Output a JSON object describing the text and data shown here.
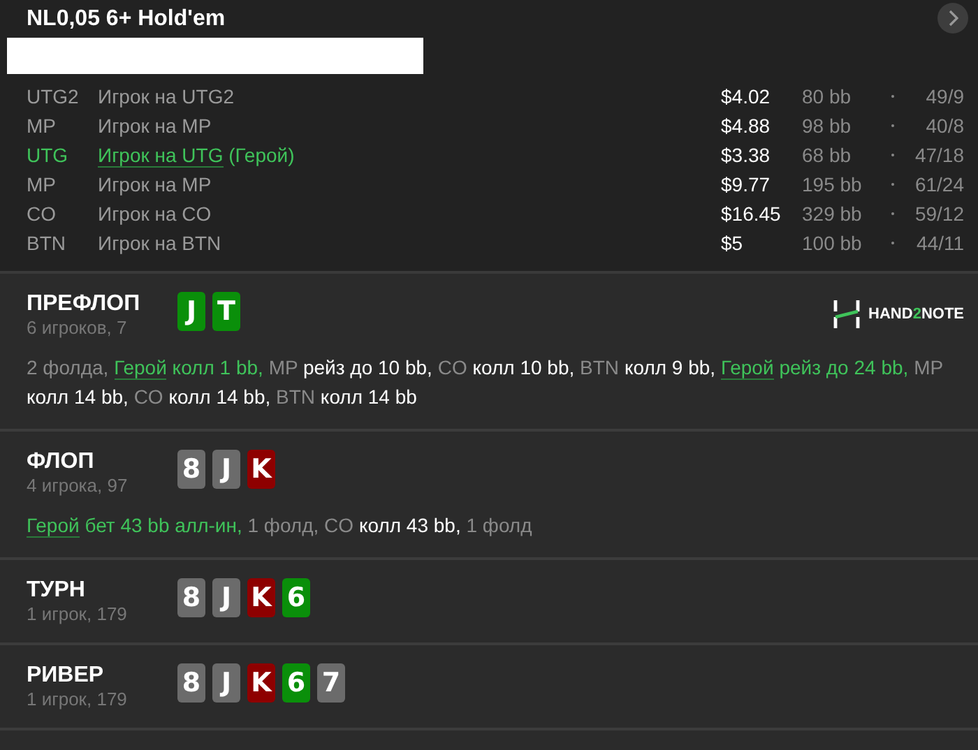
{
  "header": {
    "title": "NL0,05 6+ Hold'em"
  },
  "players": [
    {
      "position": "UTG2",
      "name": "Игрок на UTG2",
      "hero": false,
      "stack": "$4.02",
      "bb": "80 bb",
      "stats": "49/9"
    },
    {
      "position": "MP",
      "name": "Игрок на MP",
      "hero": false,
      "stack": "$4.88",
      "bb": "98 bb",
      "stats": "40/8"
    },
    {
      "position": "UTG",
      "name": "Игрок на UTG",
      "hero": true,
      "hero_tag": "(Герой)",
      "stack": "$3.38",
      "bb": "68 bb",
      "stats": "47/18"
    },
    {
      "position": "MP",
      "name": "Игрок на MP",
      "hero": false,
      "stack": "$9.77",
      "bb": "195 bb",
      "stats": "61/24"
    },
    {
      "position": "CO",
      "name": "Игрок на CO",
      "hero": false,
      "stack": "$16.45",
      "bb": "329 bb",
      "stats": "59/12"
    },
    {
      "position": "BTN",
      "name": "Игрок на BTN",
      "hero": false,
      "stack": "$5",
      "bb": "100 bb",
      "stats": "44/11"
    }
  ],
  "streets": [
    {
      "name": "ПРЕФЛОП",
      "info": "6 игроков, 7",
      "logo": [
        {
          "text": "HAND",
          "accent": false
        },
        {
          "text": "2",
          "accent": true
        },
        {
          "text": "NOTE",
          "accent": false
        }
      ],
      "cards": [
        {
          "rank": "J",
          "color": "#0a8f0a"
        },
        {
          "rank": "T",
          "color": "#0a8f0a"
        }
      ],
      "actions": [
        {
          "kind": "muted",
          "text": "2 фолда,"
        },
        {
          "kind": "hero",
          "text": "Герой"
        },
        {
          "kind": "hero_action",
          "text": "колл 1 bb,"
        },
        {
          "kind": "muted",
          "text": "MP"
        },
        {
          "kind": "action",
          "text": "рейз до 10 bb,"
        },
        {
          "kind": "muted",
          "text": "CO"
        },
        {
          "kind": "action",
          "text": "колл 10 bb,"
        },
        {
          "kind": "muted",
          "text": "BTN"
        },
        {
          "kind": "action",
          "text": "колл 9 bb,"
        },
        {
          "kind": "hero",
          "text": "Герой"
        },
        {
          "kind": "hero_action",
          "text": "рейз до 24 bb,"
        },
        {
          "kind": "muted",
          "text": "MP"
        },
        {
          "kind": "action",
          "text": "колл 14 bb,"
        },
        {
          "kind": "muted",
          "text": "CO"
        },
        {
          "kind": "action",
          "text": "колл 14 bb,"
        },
        {
          "kind": "muted",
          "text": "BTN"
        },
        {
          "kind": "action",
          "text": "колл 14 bb"
        }
      ]
    },
    {
      "name": "ФЛОП",
      "info": "4 игрока, 97",
      "cards": [
        {
          "rank": "8",
          "color": "#6b6b6b"
        },
        {
          "rank": "J",
          "color": "#6b6b6b"
        },
        {
          "rank": "K",
          "color": "#8e0000"
        }
      ],
      "actions": [
        {
          "kind": "hero",
          "text": "Герой"
        },
        {
          "kind": "hero_action",
          "text": "бет 43 bb алл-ин,"
        },
        {
          "kind": "muted",
          "text": "1 фолд, CO"
        },
        {
          "kind": "action",
          "text": "колл 43 bb,"
        },
        {
          "kind": "muted",
          "text": "1 фолд"
        }
      ]
    },
    {
      "name": "ТУРН",
      "info": "1 игрок, 179",
      "cards": [
        {
          "rank": "8",
          "color": "#6b6b6b"
        },
        {
          "rank": "J",
          "color": "#6b6b6b"
        },
        {
          "rank": "K",
          "color": "#8e0000"
        },
        {
          "rank": "6",
          "color": "#0a8f0a"
        }
      ]
    },
    {
      "name": "РИВЕР",
      "info": "1 игрок, 179",
      "cards": [
        {
          "rank": "8",
          "color": "#6b6b6b"
        },
        {
          "rank": "J",
          "color": "#6b6b6b"
        },
        {
          "rank": "K",
          "color": "#8e0000"
        },
        {
          "rank": "6",
          "color": "#0a8f0a"
        },
        {
          "rank": "7",
          "color": "#6b6b6b"
        }
      ]
    }
  ]
}
